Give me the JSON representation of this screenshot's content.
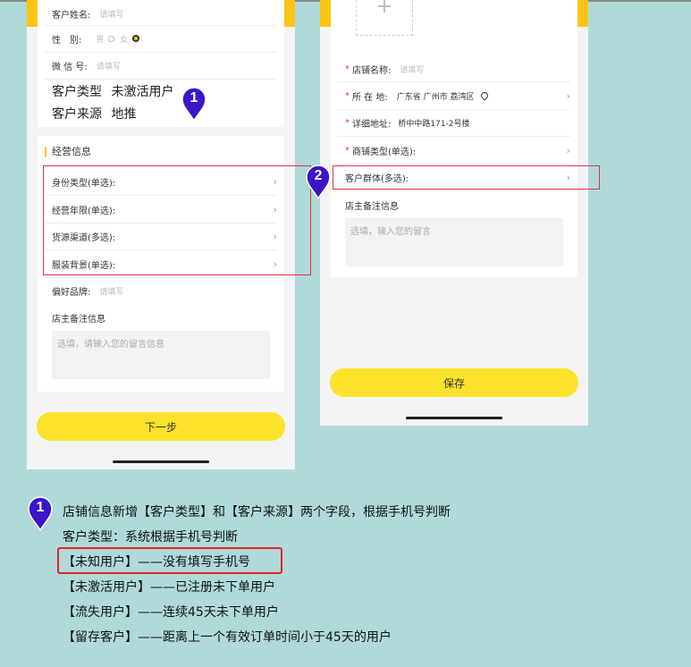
{
  "phone1": {
    "fields_top": [
      {
        "label": "客户姓名:",
        "placeholder": "请填写"
      },
      {
        "label": "性　别:",
        "opt_male": "男",
        "opt_female": "女"
      },
      {
        "label": "微 信 号:",
        "placeholder": "请填写"
      }
    ],
    "customer_type": {
      "label": "客户类型",
      "value": "未激活用户"
    },
    "customer_source": {
      "label": "客户来源",
      "value": "地推"
    },
    "section_title": "经营信息",
    "selects": [
      {
        "label": "身份类型(单选):"
      },
      {
        "label": "经营年限(单选):"
      },
      {
        "label": "货源渠道(多选):"
      },
      {
        "label": "服装背景(单选):"
      }
    ],
    "brand": {
      "label": "偏好品牌:",
      "placeholder": "请填写"
    },
    "remark_label": "店主备注信息",
    "remark_placeholder": "选填，请输入您的留言信息",
    "next_button": "下一步"
  },
  "phone2": {
    "upload_icon": "+",
    "fields": [
      {
        "label": "店铺名称:",
        "placeholder": "请填写",
        "required": "*"
      },
      {
        "label": "所 在 地:",
        "value": "广东省 广州市 荔湾区",
        "required": "*"
      },
      {
        "label": "详细地址:",
        "value": "桥中中路171-2号楼",
        "required": "*"
      },
      {
        "label": "商铺类型(单选):",
        "required": "*"
      }
    ],
    "customer_group": {
      "label": "客户群体(多选):"
    },
    "remark_label": "店主备注信息",
    "remark_placeholder": "选填，输入您的留言",
    "save_button": "保存"
  },
  "markers": {
    "one": "1",
    "two": "2"
  },
  "notes": {
    "line1": "店铺信息新增【客户类型】和【客户来源】两个字段，根据手机号判断",
    "line2": "客户类型：系统根据手机号判断",
    "line3": "【未知用户】——没有填写手机号",
    "line4": "【未激活用户】——已注册未下单用户",
    "line5": "【流失用户】——连续45天未下单用户",
    "line6": "【留存客户】——距离上一个有效订单时间小于45天的用户"
  },
  "colors": {
    "accent_yellow": "#fde22c",
    "marker_purple": "#3a16c8",
    "highlight_red": "#d8334a",
    "background": "#b0d9d9"
  },
  "icons": {
    "chevron": "chevron-right-icon",
    "location": "location-pin-icon",
    "radio": "radio-icon",
    "upload": "plus-icon"
  }
}
